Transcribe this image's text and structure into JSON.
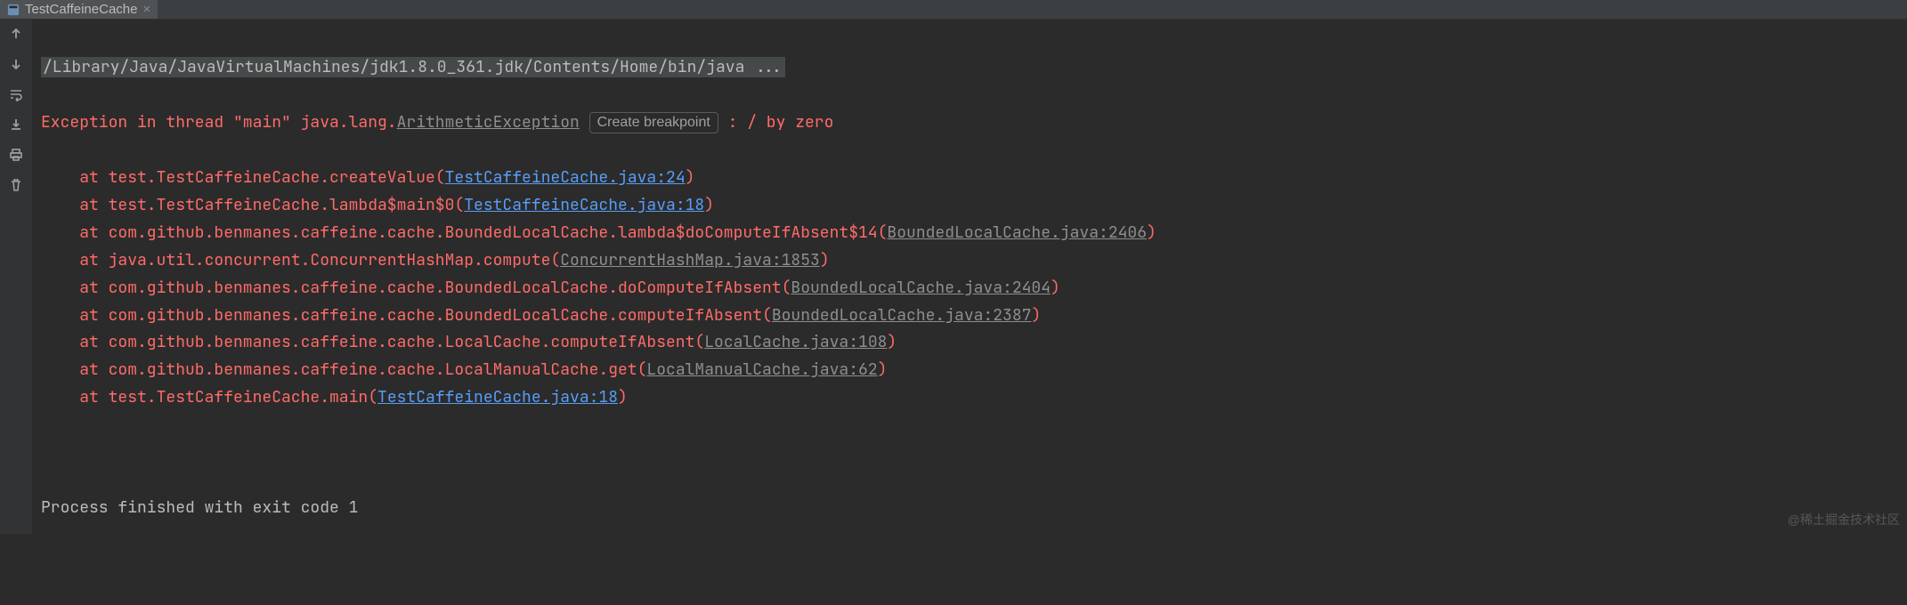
{
  "tab": {
    "title": "TestCaffeineCache"
  },
  "gutter_icons": [
    "arrow-up-icon",
    "arrow-down-icon",
    "wrap-icon",
    "download-icon",
    "print-icon",
    "trash-icon"
  ],
  "console": {
    "command": "/Library/Java/JavaVirtualMachines/jdk1.8.0_361.jdk/Contents/Home/bin/java ...",
    "exception_prefix": "Exception in thread \"main\" ",
    "exception_class_pkg": "java.lang.",
    "exception_class_link": "ArithmeticException",
    "breakpoint_label": "Create breakpoint",
    "exception_message": " : / by zero",
    "frames": [
      {
        "at": "    at ",
        "loc": "test.TestCaffeineCache.createValue",
        "file": "TestCaffeineCache.java:24",
        "link": "blue"
      },
      {
        "at": "    at ",
        "loc": "test.TestCaffeineCache.lambda$main$0",
        "file": "TestCaffeineCache.java:18",
        "link": "blue"
      },
      {
        "at": "    at ",
        "loc": "com.github.benmanes.caffeine.cache.BoundedLocalCache.lambda$doComputeIfAbsent$14",
        "file": "BoundedLocalCache.java:2406",
        "link": "gray"
      },
      {
        "at": "    at ",
        "loc": "java.util.concurrent.ConcurrentHashMap.compute",
        "file": "ConcurrentHashMap.java:1853",
        "link": "gray"
      },
      {
        "at": "    at ",
        "loc": "com.github.benmanes.caffeine.cache.BoundedLocalCache.doComputeIfAbsent",
        "file": "BoundedLocalCache.java:2404",
        "link": "gray"
      },
      {
        "at": "    at ",
        "loc": "com.github.benmanes.caffeine.cache.BoundedLocalCache.computeIfAbsent",
        "file": "BoundedLocalCache.java:2387",
        "link": "gray"
      },
      {
        "at": "    at ",
        "loc": "com.github.benmanes.caffeine.cache.LocalCache.computeIfAbsent",
        "file": "LocalCache.java:108",
        "link": "gray"
      },
      {
        "at": "    at ",
        "loc": "com.github.benmanes.caffeine.cache.LocalManualCache.get",
        "file": "LocalManualCache.java:62",
        "link": "gray"
      },
      {
        "at": "    at ",
        "loc": "test.TestCaffeineCache.main",
        "file": "TestCaffeineCache.java:18",
        "link": "blue"
      }
    ],
    "exit_line": "Process finished with exit code 1"
  },
  "watermark": "@稀土掘金技术社区"
}
